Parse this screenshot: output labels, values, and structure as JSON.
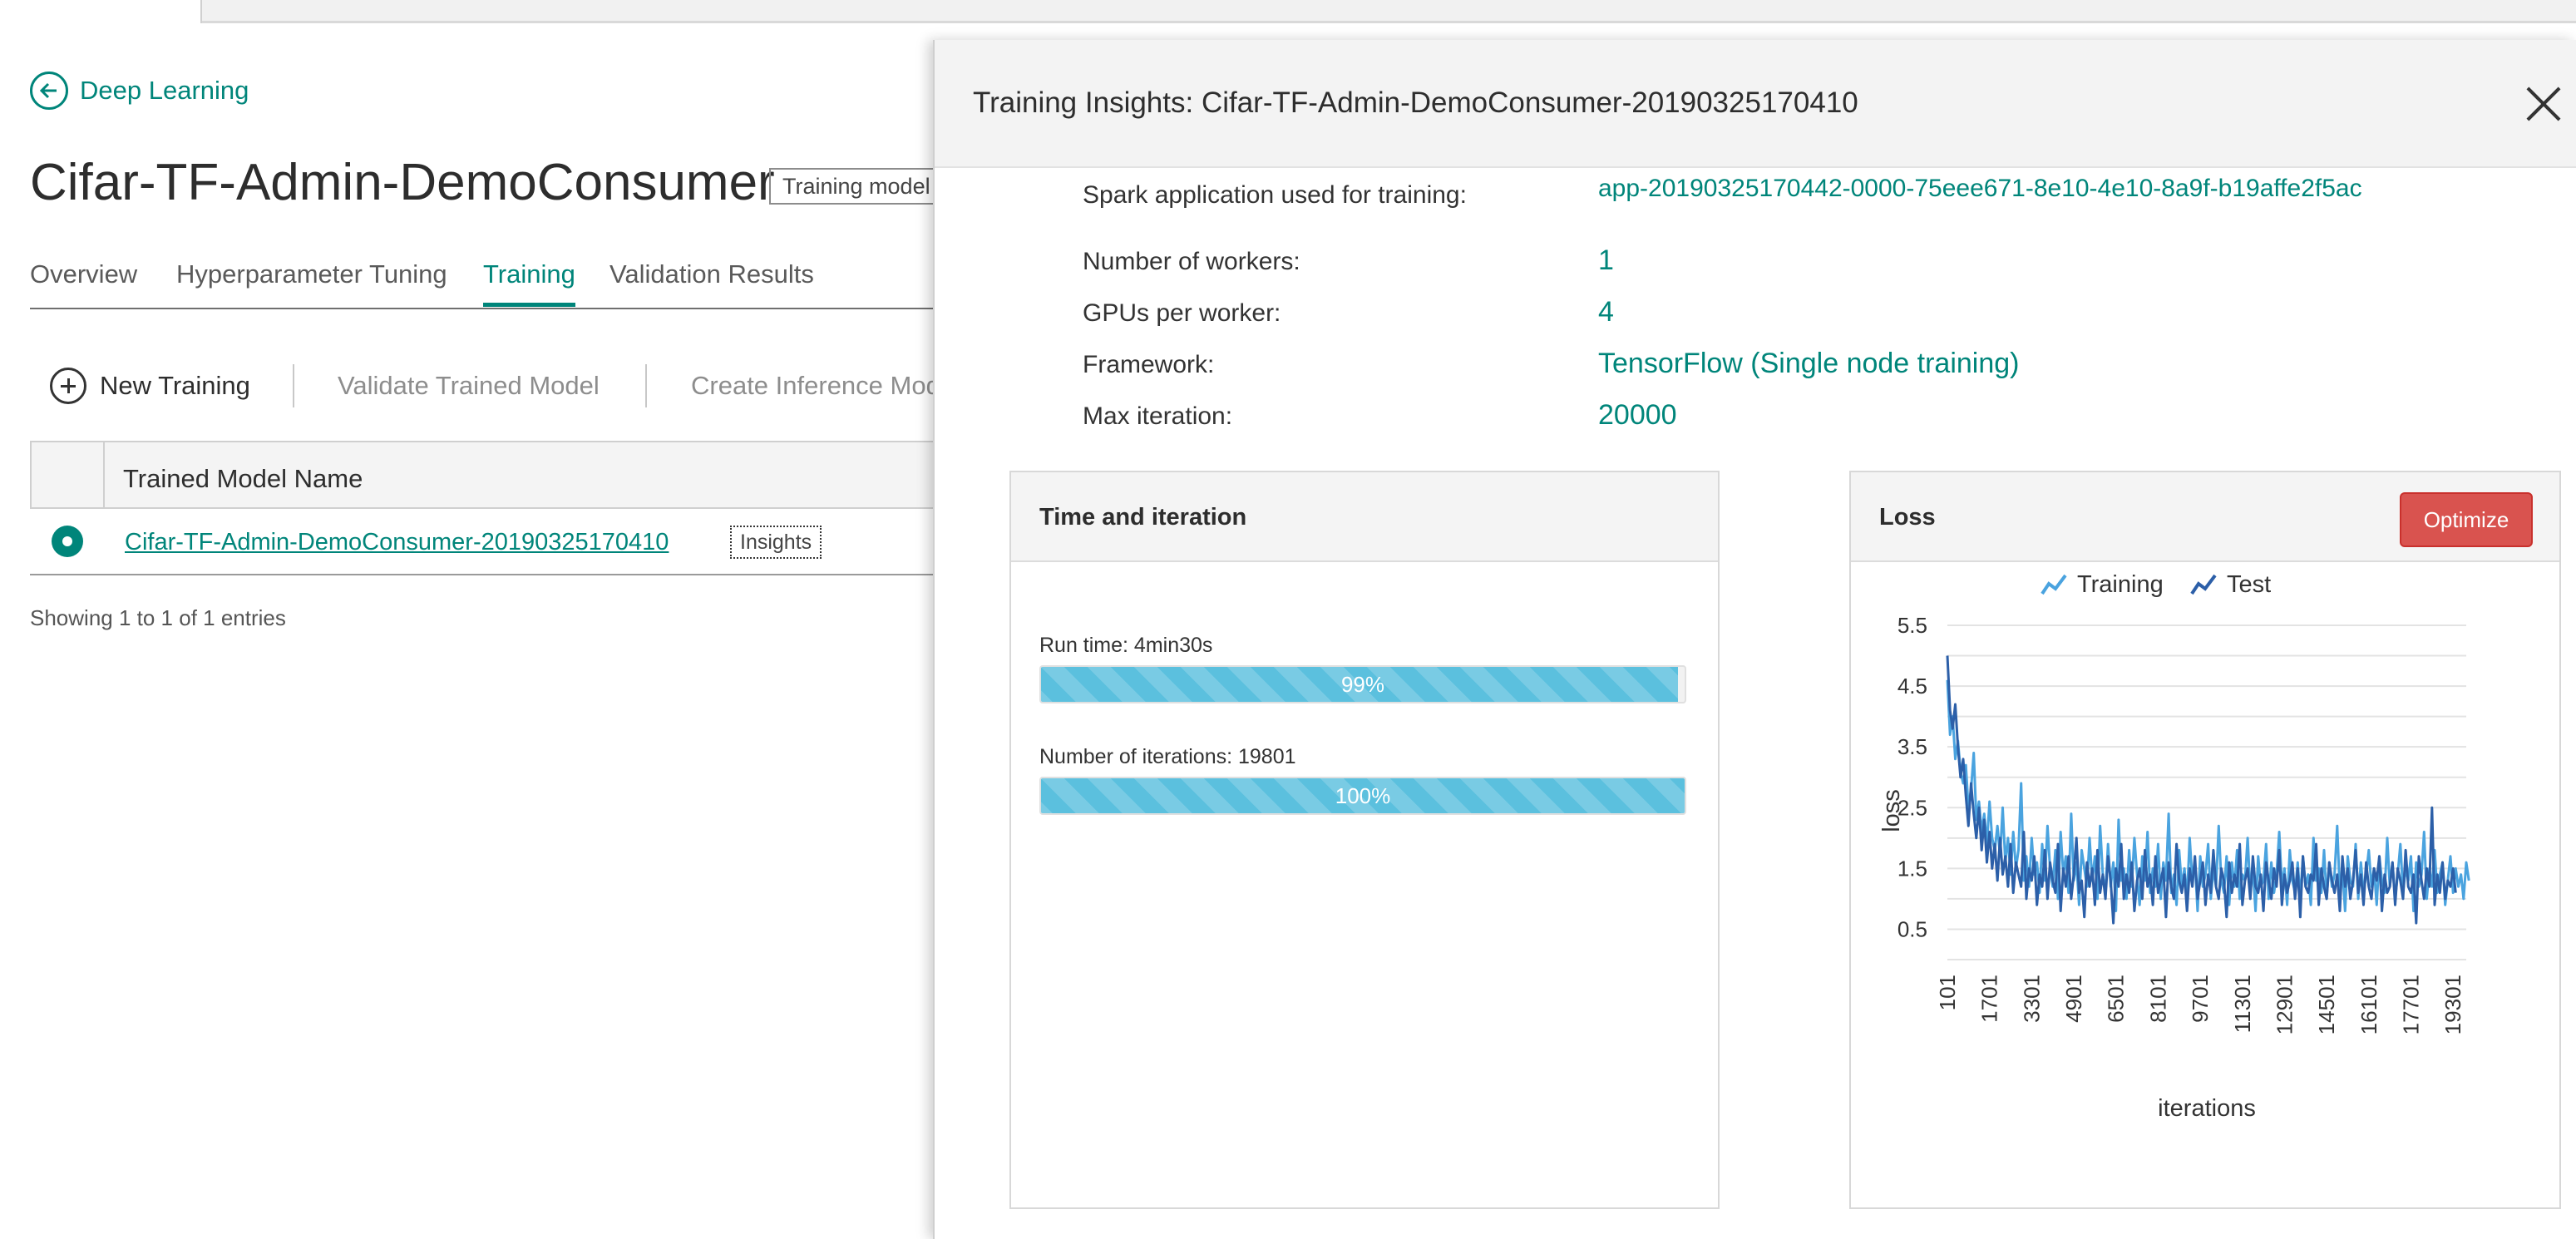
{
  "nav": {
    "back_label": "Deep Learning"
  },
  "page": {
    "title": "Cifar-TF-Admin-DemoConsumer",
    "badge": "Training model"
  },
  "tabs": [
    {
      "label": "Overview"
    },
    {
      "label": "Hyperparameter Tuning"
    },
    {
      "label": "Training",
      "active": true
    },
    {
      "label": "Validation Results"
    }
  ],
  "toolbar": {
    "new_training": "New Training",
    "validate": "Validate Trained Model",
    "create_inference": "Create Inference Model"
  },
  "table": {
    "column": "Trained Model Name",
    "rows": [
      {
        "name": "Cifar-TF-Admin-DemoConsumer-20190325170410",
        "action": "Insights",
        "selected": true
      }
    ],
    "footer": "Showing 1 to 1 of 1 entries"
  },
  "panel": {
    "title": "Training Insights: Cifar-TF-Admin-DemoConsumer-20190325170410",
    "info": {
      "spark_label": "Spark application used for training:",
      "spark_value": "app-20190325170442-0000-75eee671-8e10-4e10-8a9f-b19affe2f5ac",
      "workers_label": "Number of workers:",
      "workers_value": "1",
      "gpus_label": "GPUs per worker:",
      "gpus_value": "4",
      "framework_label": "Framework:",
      "framework_value": "TensorFlow (Single node training)",
      "maxiter_label": "Max iteration:",
      "maxiter_value": "20000"
    },
    "time_card": {
      "title": "Time and iteration",
      "runtime_label": "Run time: 4min30s",
      "runtime_percent": 99,
      "runtime_text": "99%",
      "iterations_label": "Number of iterations: 19801",
      "iterations_percent": 100,
      "iterations_text": "100%"
    },
    "loss_card": {
      "title": "Loss",
      "optimize_label": "Optimize"
    }
  },
  "colors": {
    "accent": "#00857a",
    "danger": "#d9534f",
    "progress": "#5bc0de",
    "training_series": "#4aa3df",
    "test_series": "#2c5fa8"
  },
  "chart_data": {
    "type": "line",
    "xlabel": "iterations",
    "ylabel": "loss",
    "y_ticks": [
      0.5,
      1.5,
      2.5,
      3.5,
      4.5,
      5.5
    ],
    "ylim": [
      0,
      5.5
    ],
    "x_ticks": [
      "101",
      "1701",
      "3301",
      "4901",
      "6501",
      "8101",
      "9701",
      "11301",
      "12901",
      "14501",
      "16101",
      "17701",
      "19301"
    ],
    "xlim": [
      101,
      19801
    ],
    "x_step": 100,
    "grid": true,
    "legend_position": "top",
    "series": [
      {
        "name": "Training",
        "values": [
          4.6,
          3.7,
          4.0,
          3.3,
          3.6,
          3.1,
          2.9,
          3.2,
          2.5,
          2.8,
          3.4,
          2.3,
          2.6,
          2.1,
          2.4,
          1.9,
          2.6,
          2.0,
          1.8,
          2.2,
          1.7,
          2.5,
          1.6,
          2.0,
          1.4,
          2.1,
          1.5,
          1.8,
          2.9,
          1.3,
          1.7,
          1.2,
          2.0,
          1.4,
          1.6,
          1.1,
          1.9,
          1.3,
          2.2,
          1.5,
          1.2,
          1.8,
          1.0,
          2.1,
          1.4,
          1.7,
          1.1,
          2.4,
          1.3,
          1.6,
          0.9,
          1.8,
          1.5,
          1.2,
          2.0,
          1.3,
          1.7,
          1.0,
          2.2,
          1.4,
          1.1,
          1.9,
          1.2,
          1.6,
          0.8,
          2.3,
          1.3,
          1.5,
          1.0,
          1.8,
          1.2,
          2.0,
          1.4,
          0.9,
          1.7,
          1.3,
          2.1,
          1.1,
          1.5,
          1.2,
          1.9,
          1.0,
          1.6,
          1.3,
          2.4,
          1.1,
          1.4,
          0.9,
          1.8,
          1.2,
          1.5,
          1.0,
          2.0,
          1.3,
          1.6,
          0.8,
          1.7,
          1.2,
          1.4,
          1.9,
          1.0,
          1.5,
          1.2,
          2.2,
          1.3,
          1.1,
          1.7,
          0.9,
          1.6,
          1.2,
          1.8,
          1.0,
          1.4,
          1.3,
          2.0,
          1.1,
          1.5,
          0.8,
          1.7,
          1.2,
          1.3,
          1.9,
          1.0,
          1.6,
          1.1,
          1.4,
          2.1,
          1.2,
          1.5,
          0.9,
          1.8,
          1.3,
          1.1,
          1.6,
          1.0,
          1.7,
          1.2,
          1.4,
          0.9,
          2.0,
          1.3,
          1.5,
          1.1,
          1.8,
          1.0,
          1.6,
          1.2,
          1.4,
          2.2,
          1.1,
          1.5,
          0.8,
          1.7,
          1.3,
          1.2,
          1.9,
          1.0,
          1.6,
          1.1,
          1.4,
          1.8,
          1.2,
          1.5,
          0.9,
          1.7,
          1.3,
          1.1,
          2.0,
          1.2,
          1.6,
          1.0,
          1.4,
          1.9,
          1.1,
          1.5,
          1.3,
          1.7,
          0.8,
          1.6,
          1.2,
          1.4,
          2.1,
          1.0,
          1.5,
          1.2,
          1.8,
          1.1,
          1.4,
          1.6,
          0.9,
          1.3,
          1.7,
          1.1,
          1.5,
          1.2,
          1.4,
          1.0,
          1.6,
          1.3
        ]
      },
      {
        "name": "Test",
        "values": [
          5.0,
          4.1,
          3.8,
          4.2,
          3.5,
          3.0,
          3.3,
          2.7,
          2.2,
          2.9,
          2.4,
          2.0,
          2.5,
          1.8,
          2.3,
          1.6,
          2.1,
          1.5,
          1.9,
          1.3,
          2.0,
          1.4,
          1.7,
          1.2,
          1.9,
          1.1,
          1.6,
          1.4,
          1.2,
          2.1,
          1.0,
          1.5,
          1.3,
          1.7,
          0.9,
          1.4,
          1.2,
          1.8,
          1.0,
          1.6,
          1.3,
          1.1,
          1.9,
          0.8,
          1.5,
          1.2,
          1.7,
          1.0,
          1.4,
          2.0,
          1.1,
          1.3,
          0.7,
          1.6,
          1.2,
          1.5,
          0.9,
          1.8,
          1.1,
          1.4,
          1.0,
          1.7,
          1.3,
          0.6,
          1.5,
          1.2,
          1.9,
          1.0,
          1.4,
          1.1,
          1.6,
          0.8,
          1.3,
          1.5,
          1.0,
          1.8,
          1.2,
          1.4,
          0.9,
          1.7,
          1.1,
          1.3,
          1.5,
          0.7,
          1.6,
          1.2,
          1.0,
          1.9,
          1.3,
          1.1,
          1.4,
          0.8,
          1.5,
          1.2,
          1.7,
          1.0,
          1.3,
          1.6,
          0.9,
          1.4,
          1.1,
          1.8,
          1.2,
          1.0,
          1.5,
          1.3,
          0.7,
          1.6,
          1.1,
          1.4,
          1.2,
          1.9,
          0.9,
          1.3,
          1.5,
          1.0,
          1.7,
          1.2,
          1.1,
          1.4,
          0.8,
          1.6,
          1.3,
          1.0,
          1.5,
          1.2,
          1.8,
          0.9,
          1.4,
          1.1,
          1.3,
          1.6,
          1.0,
          1.5,
          0.7,
          1.7,
          1.2,
          1.1,
          1.4,
          1.3,
          1.9,
          0.9,
          1.5,
          1.2,
          1.0,
          1.6,
          1.3,
          1.1,
          1.4,
          0.8,
          1.7,
          1.2,
          1.5,
          1.0,
          1.3,
          1.8,
          1.1,
          1.4,
          0.9,
          1.6,
          1.2,
          1.0,
          1.5,
          1.3,
          1.7,
          0.8,
          1.4,
          1.1,
          1.2,
          1.6,
          0.9,
          1.5,
          1.3,
          1.0,
          1.8,
          1.2,
          1.1,
          1.4,
          0.6,
          1.7,
          1.3,
          1.0,
          1.5,
          1.2,
          2.5,
          0.9,
          1.4,
          1.1,
          1.6,
          1.0,
          1.3,
          1.2,
          1.5,
          1.1
        ]
      }
    ]
  }
}
